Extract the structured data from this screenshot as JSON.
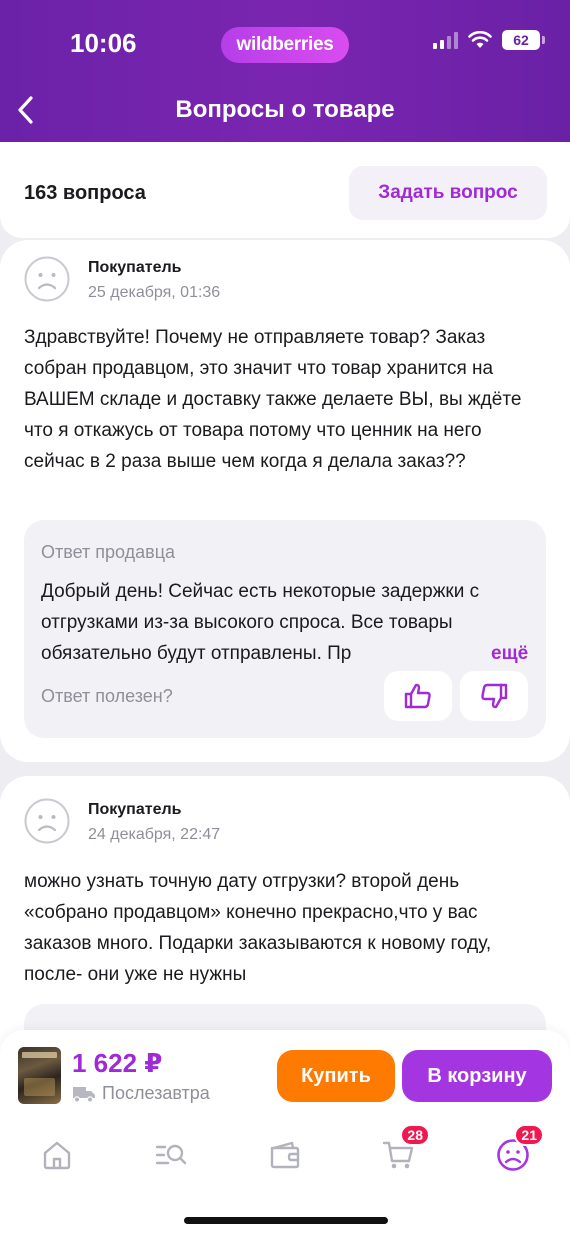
{
  "status_bar": {
    "time": "10:06",
    "brand": "wildberries",
    "battery": "62"
  },
  "header": {
    "title": "Вопросы о товаре",
    "back_icon": "chevron-left-icon"
  },
  "questions_summary": {
    "count_text": "163 вопроса",
    "ask_button": "Задать вопрос"
  },
  "questions": [
    {
      "author": "Покупатель",
      "date": "25 декабря, 01:36",
      "text": "Здравствуйте! Почему не отправляете товар? Заказ собран продавцом, это значит что товар хранится на ВАШЕМ складе и доставку также делаете ВЫ, вы ждёте что я откажусь от товара потому что ценник на него сейчас в 2 раза выше чем когда я делала заказ??",
      "answer": {
        "label": "Ответ продавца",
        "text": "Добрый день! Сейчас есть некоторые задержки с отгрузками из-за высокого спроса. Все товары обязательно будут отправлены. Пр",
        "more": "ещё",
        "useful_prompt": "Ответ полезен?"
      }
    },
    {
      "author": "Покупатель",
      "date": "24 декабря, 22:47",
      "text": "можно узнать точную дату отгрузки? второй день «собрано продавцом» конечно прекрасно,что у вас заказов много. Подарки заказываются к новому году, после- они уже не нужны"
    }
  ],
  "product_bar": {
    "price": "1 622 ₽",
    "delivery": "Послезавтра",
    "buy_button": "Купить",
    "cart_button": "В корзину"
  },
  "tab_bar": {
    "items": [
      {
        "icon": "home-icon"
      },
      {
        "icon": "catalog-search-icon"
      },
      {
        "icon": "wallet-icon"
      },
      {
        "icon": "cart-icon",
        "badge": "28"
      },
      {
        "icon": "profile-icon",
        "badge": "21"
      }
    ]
  },
  "colors": {
    "brand_purple": "#7a25b0",
    "accent": "#a02bd6",
    "buy_orange": "#ff7a00",
    "badge_red": "#f0194f"
  }
}
